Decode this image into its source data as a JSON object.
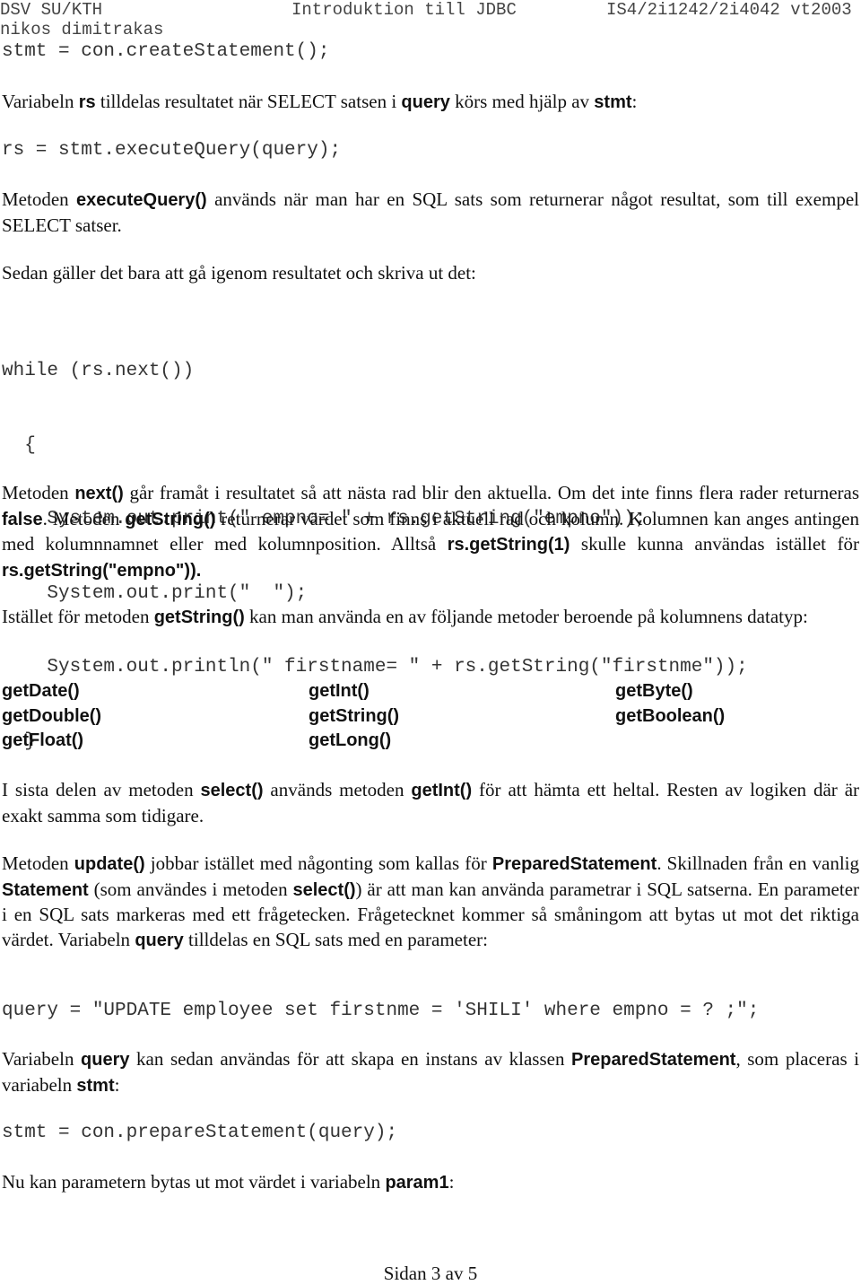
{
  "header": {
    "left_line1": "DSV SU/KTH",
    "left_line2": "nikos dimitrakas",
    "center": "Introduktion till JDBC",
    "right": "IS4/2i1242/2i4042 vt2003"
  },
  "code1": "stmt = con.createStatement();",
  "para1": {
    "t1": "Variabeln ",
    "k1": "rs",
    "t2": " tilldelas resultatet när SELECT satsen i ",
    "k2": "query",
    "t3": " körs med hjälp av ",
    "k3": "stmt",
    "t4": ":"
  },
  "code2": "rs = stmt.executeQuery(query);",
  "para2": {
    "t1": "Metoden ",
    "k1": "executeQuery()",
    "t2": " används när man har en SQL sats som returnerar något resultat, som till exempel SELECT satser."
  },
  "para3": "Sedan gäller det bara att gå igenom resultatet och skriva ut det:",
  "code3": [
    "while (rs.next())",
    "  {",
    "    System.out.print(\" empno= \" + rs.getString(\"empno\"));",
    "    System.out.print(\"  \");",
    "    System.out.println(\" firstname= \" + rs.getString(\"firstnme\"));",
    "  }"
  ],
  "para4": {
    "t1": "Metoden ",
    "k1": "next()",
    "t2": " går framåt i resultatet så att nästa rad blir den aktuella. Om det inte finns flera rader returneras ",
    "k2": "false",
    "t3": ". Metoden ",
    "k3": "getString()",
    "t4": " returnerar värdet som finns i aktuell rad och kolumn. Kolumnen kan anges antingen med kolumnnamnet eller med kolumnposition. Alltså ",
    "k4": "rs.getString(1)",
    "t5": " skulle kunna användas istället för ",
    "k5": "rs.getString(\"empno\"))."
  },
  "para5": {
    "t1": "Istället för metoden ",
    "k1": "getString()",
    "t2": " kan man använda en av följande metoder beroende på kolumnens datatyp:"
  },
  "methods": {
    "col1": [
      "getDate()",
      "getDouble()",
      "getFloat()"
    ],
    "col2": [
      "getInt()",
      "getString()",
      "getLong()"
    ],
    "col3": [
      "getByte()",
      "getBoolean()"
    ]
  },
  "para6": {
    "t1": "I sista delen av metoden ",
    "k1": "select()",
    "t2": " används metoden ",
    "k2": "getInt()",
    "t3": " för att hämta ett heltal. Resten av logiken där är exakt samma som tidigare."
  },
  "para7": {
    "t1": "Metoden ",
    "k1": "update()",
    "t2": " jobbar istället med någonting som kallas för ",
    "k2": "PreparedStatement",
    "t3": ". Skillnaden från en vanlig ",
    "k3": "Statement",
    "t4": " (som användes i metoden ",
    "k4": "select()",
    "t5": ") är att man kan använda parametrar i SQL satserna. En parameter i en SQL sats markeras med ett frågetecken. Frågetecknet kommer så småningom att bytas ut mot det riktiga värdet. Variabeln ",
    "k5": "query",
    "t6": " tilldelas en SQL sats med en parameter:"
  },
  "code4": "query = \"UPDATE employee set firstnme = 'SHILI' where empno = ? ;\";",
  "para8": {
    "t1": "Variabeln ",
    "k1": "query",
    "t2": " kan sedan användas för att skapa en instans av klassen ",
    "k2": "PreparedStatement",
    "t3": ", som placeras i variabeln ",
    "k3": "stmt",
    "t4": ":"
  },
  "code5": "stmt = con.prepareStatement(query);",
  "para9": {
    "t1": "Nu kan parametern bytas ut mot värdet i variabeln ",
    "k1": "param1",
    "t2": ":"
  },
  "footer": "Sidan 3 av 5"
}
